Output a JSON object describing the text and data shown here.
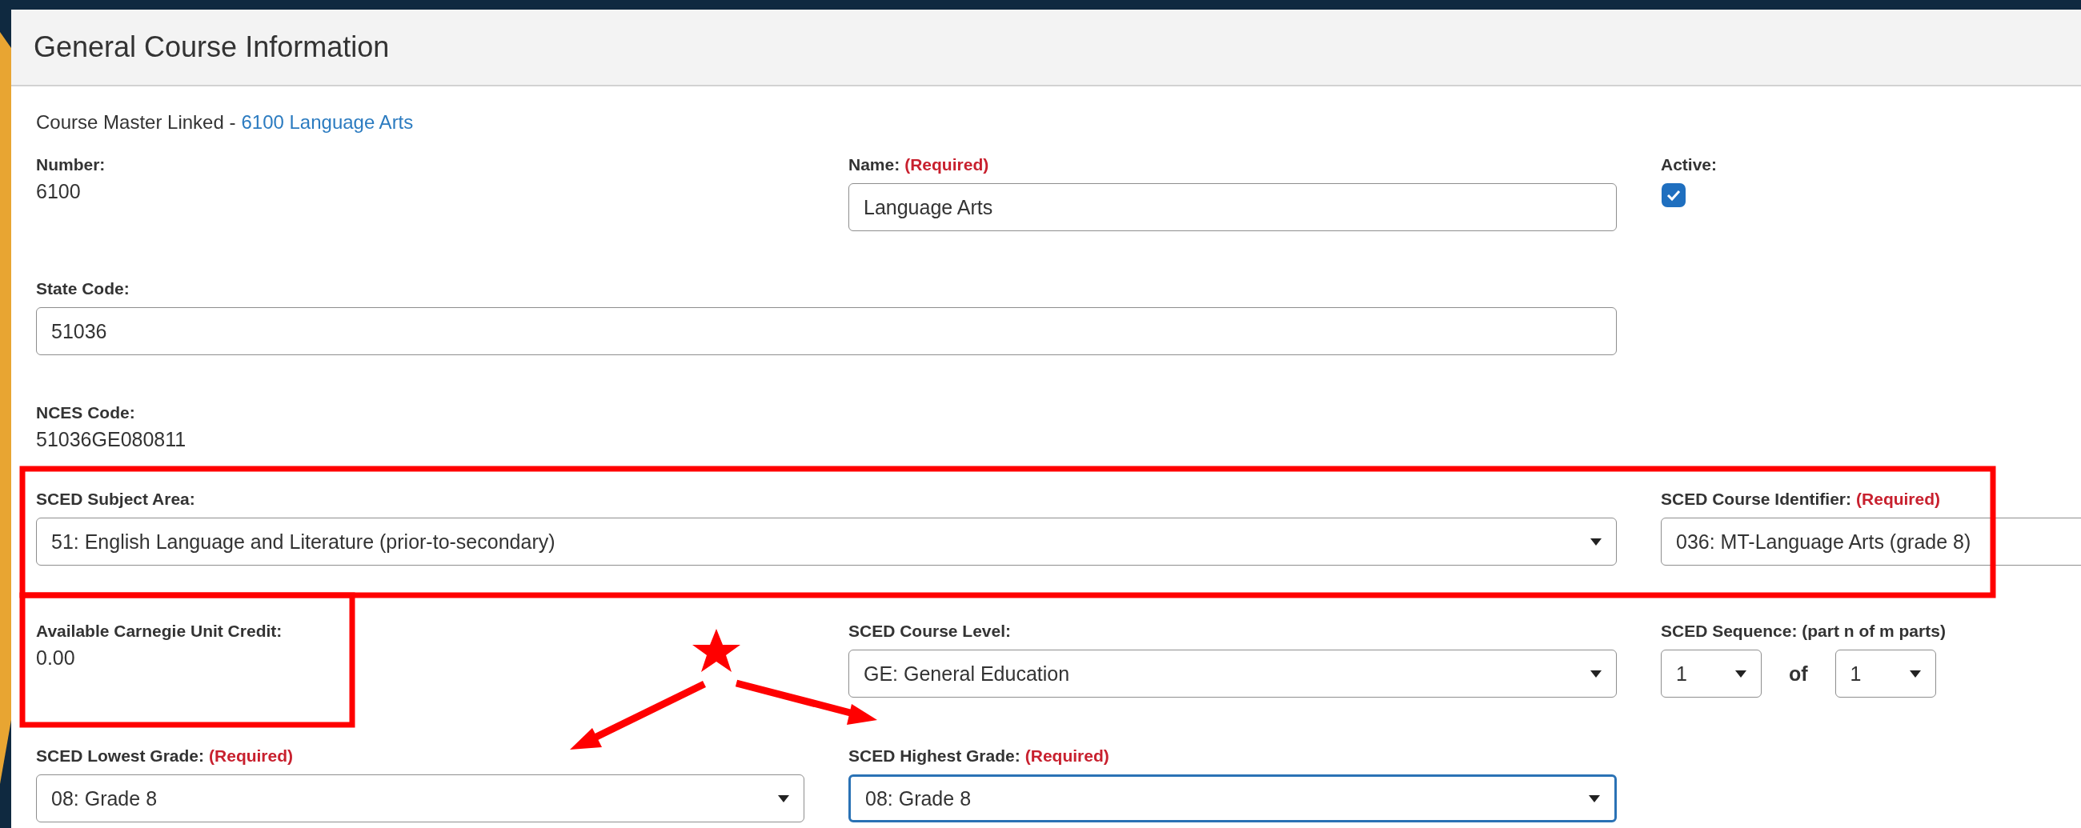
{
  "panel": {
    "title": "General Course Information"
  },
  "course_master": {
    "label": "Course Master Linked -",
    "link": "6100 Language Arts"
  },
  "rows": [
    [
      {
        "kind": "static",
        "label": "Number:",
        "value": "6100"
      },
      {
        "kind": "input",
        "label": "Name:",
        "required_note": "(Required)",
        "value": "Language Arts",
        "focused": false
      },
      {
        "kind": "checkbox",
        "label": "Active:",
        "checked": true
      }
    ],
    [
      {
        "kind": "input",
        "label": "State Code:",
        "value": "51036",
        "focused": false
      }
    ],
    [
      {
        "kind": "static",
        "label": "NCES Code:",
        "value": "51036GE080811"
      }
    ],
    [
      {
        "kind": "select",
        "label": "SCED Subject Area:",
        "value": "51: English Language and Literature (prior-to-secondary)",
        "focused": false
      },
      {
        "kind": "select",
        "label": "SCED Course Identifier:",
        "required_note": "(Required)",
        "value": "036: MT-Language Arts (grade 8)",
        "focused": false
      }
    ],
    [
      {
        "kind": "static",
        "label": "Available Carnegie Unit Credit:",
        "value": "0.00"
      },
      {
        "kind": "select",
        "label": "SCED Course Level:",
        "value": "GE: General Education",
        "focused": false
      },
      {
        "kind": "sequence",
        "label": "SCED Sequence: (part n of m parts)",
        "part": "1",
        "joiner": "of",
        "total": "1"
      }
    ],
    [
      {
        "kind": "select",
        "label": "SCED Lowest Grade:",
        "required_note": "(Required)",
        "value": "08: Grade 8",
        "focused": false
      },
      {
        "kind": "select",
        "label": "SCED Highest Grade:",
        "required_note": "(Required)",
        "value": "08: Grade 8",
        "focused": true
      }
    ]
  ]
}
